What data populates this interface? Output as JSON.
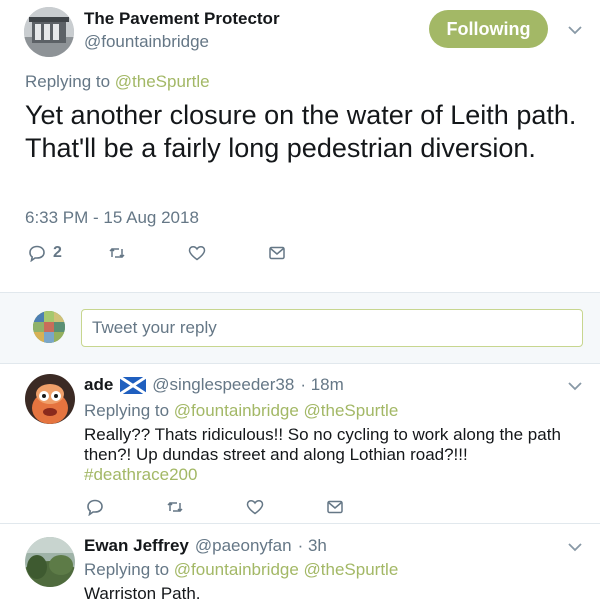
{
  "main_tweet": {
    "display_name": "The Pavement Protector",
    "handle": "@fountainbridge",
    "follow_label": "Following",
    "replying_prefix": "Replying to",
    "replying_to": "@theSpurtle",
    "text": "Yet another closure on the water of Leith path. That'll be a fairly long pedestrian diversion.",
    "timestamp": "6:33 PM - 15 Aug 2018",
    "reply_count": "2"
  },
  "compose": {
    "placeholder": "Tweet your reply"
  },
  "replies": [
    {
      "display_name": "ade",
      "handle": "@singlespeeder38",
      "time": "· 18m",
      "replying_prefix": "Replying to",
      "replying_to": "@fountainbridge @theSpurtle",
      "text": "Really?? Thats ridiculous!! So no cycling to work along the path then?! Up dundas street and along Lothian road?!!!",
      "hashtag": "#deathrace200"
    },
    {
      "display_name": "Ewan Jeffrey",
      "handle": "@paeonyfan",
      "time": "· 3h",
      "replying_prefix": "Replying to",
      "replying_to": "@fountainbridge @theSpurtle",
      "text": "Warriston Path."
    }
  ],
  "colors": {
    "accent": "#a3b866",
    "text_primary": "#14171a",
    "text_secondary": "#657786",
    "divider": "#e1e8ed",
    "compose_bg": "#f5f8fa"
  },
  "icons": {
    "reply": "reply-icon",
    "retweet": "retweet-icon",
    "like": "heart-icon",
    "dm": "envelope-icon",
    "more": "chevron-down-icon",
    "flag": "scotland-flag-icon"
  }
}
